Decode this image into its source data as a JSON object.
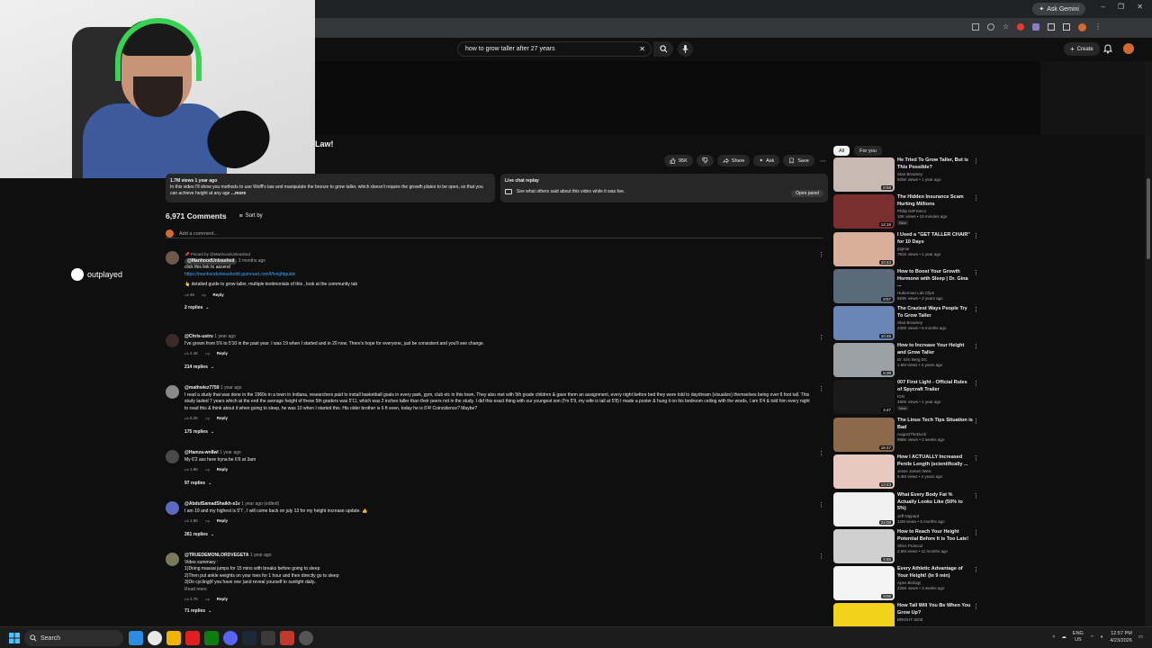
{
  "browser": {
    "ask_gemini": "Ask Gemini",
    "win_min": "–",
    "win_max": "❐",
    "win_close": "✕"
  },
  "header": {
    "search_query": "how to grow taller after 27 years",
    "create_label": "Create"
  },
  "webcam_brand": "outplayed",
  "video": {
    "title_tail": "Law!",
    "likes": "95K",
    "share": "Share",
    "ask": "Ask",
    "save": "Save",
    "desc_meta": "1.7M views  1 year ago",
    "desc_text": "In this video I'll show you methods to use Wolff's law and manipulate the bronze to grow taller, which doesn't require the growth plates to be open, so that you can achieve height at any age",
    "desc_more": "...more",
    "chat_title": "Live chat replay",
    "chat_text": "See what others said about this video while it was live.",
    "chat_open": "Open panel"
  },
  "comments_header": {
    "count": "6,971 Comments",
    "sort": "Sort by",
    "add_placeholder": "Add a comment..."
  },
  "comments": [
    {
      "pinned": "Pinned by @ManhoodUnleashed",
      "author": "@ManhoodUnleashed",
      "when": "3 months ago",
      "lines": [
        "click this link to ascend"
      ],
      "link": "https://manhoodunleashedd.gumroad.com/l/heightguide",
      "extra": "👆 detailed guide to grow taller, multiple testimonials of this , look at the community tab",
      "likes": "46",
      "reply": "Reply",
      "replies": "2 replies"
    },
    {
      "author": "@Chris-ustru",
      "when": "1 year ago",
      "lines": [
        "I've grown from 5'6 to 5'10 in the past year. I was 19 when I started and in 20 now. There's hope for everyone, just be consistent and you'll see change."
      ],
      "likes": "4.4K",
      "reply": "Reply",
      "replies": "214 replies"
    },
    {
      "author": "@mathwiez7759",
      "when": "1 year ago",
      "lines": [
        "I read a study that was done in the 1960s in a town in Indiana, researchers paid to install basketball goals in every park, gym, club etc in this town. They also met with 5th grade children & gave them an assignment, every night before bed they were told to daydream (visualize) themselves being over 6 foot tall. This study lasted 7 years which at the end the average height of these 5th graders was 5'11, which was 2 inches taller than their peers not in the study. I did this exact thing with our youngest son (I'm 5'9, my wife is tall at 5'8) I made a poster & hung it on his bedroom ceiling with the words, I am 6'4 & told him every night to read this & think about it when going to sleep, he was 10 when I started this. His older brother is 6 ft even, today he is 6'4! Coincidence? Maybe?"
      ],
      "likes": "5.2K",
      "reply": "Reply",
      "replies": "175 replies"
    },
    {
      "author": "@Hamza-wn8wl",
      "when": "1 year ago",
      "lines": [
        "My 6'2 ass here tryna be 6'6 at 3am"
      ],
      "likes": "1.8K",
      "reply": "Reply",
      "replies": "97 replies"
    },
    {
      "author": "@AbdulSamadShaikh-s1v",
      "when": "1 year ago (edited)",
      "lines": [
        "I am 19 and my highest is 5'7 , I will come back on july 13 for my height increase update. 👍"
      ],
      "likes": "1.8K",
      "reply": "Reply",
      "replies": "261 replies"
    },
    {
      "author": "@TRUEDEMONLORDVEGETA",
      "when": "1 year ago",
      "lines": [
        "Video summary :",
        "1)Doing massai jumps for 15 mins with breaks before going to sleep",
        "2)Then put ankle weights on your toes for 1 hour and then directly go to sleep",
        "3)Do cycling(if you have one )and reveal yourself to  sunlight daily.."
      ],
      "readmore": "Read more",
      "likes": "2.7K",
      "reply": "Reply",
      "replies": "71 replies"
    }
  ],
  "sidebar": {
    "chips": [
      "All",
      "For you"
    ],
    "recs": [
      {
        "title": "He Tried To Grow Taller, But is This Possible?",
        "channel": "Stan Browney",
        "stats": "925K views • 1 year ago",
        "dur": "8:58",
        "color": "#c9b9b3"
      },
      {
        "title": "The Hidden Insurance Scam Hurting Millions",
        "channel": "Philip DeFranco",
        "stats": "10K views • 19 minutes ago",
        "badge": "New",
        "dur": "14:15",
        "color": "#7a2e2e"
      },
      {
        "title": "I Used a \"GET TALLER CHAIR\" for 10 Days",
        "channel": "pigmie",
        "stats": "791K views • 1 year ago",
        "dur": "10:43",
        "color": "#d8b09a"
      },
      {
        "title": "How to Boost Your Growth Hormone with Sleep | Dr. Gina ...",
        "channel": "Huberman Lab Clips",
        "stats": "663K views • 2 years ago",
        "dur": "8:57",
        "color": "#5a6a78"
      },
      {
        "title": "The Craziest Ways People Try To Grow Taller",
        "channel": "Stan Browney",
        "stats": "230K views • 9 months ago",
        "dur": "10:45",
        "color": "#6a86b8"
      },
      {
        "title": "How to Increase Your Height and Grow Taller",
        "channel": "Dr. Eric Berg DC",
        "stats": "1.6M views • 4 years ago",
        "dur": "5:38",
        "color": "#9aa0a6"
      },
      {
        "title": "007 First Light - Official Rules of Spycraft Trailer",
        "channel": "IGN",
        "stats": "490K views • 1 year ago",
        "badge": "New",
        "dur": "4:47",
        "color": "#1a1a1a"
      },
      {
        "title": "The Linus Tech Tips Situation is Bad",
        "channel": "AugustTheDuck",
        "stats": "996K views • 2 weeks ago",
        "dur": "16:47",
        "color": "#8a6a4a"
      },
      {
        "title": "How I ACTUALLY Increased Penile Length (scientifically ...",
        "channel": "Jesse James West",
        "stats": "5.3M views • 2 years ago",
        "dur": "13:43",
        "color": "#e8c8c0"
      },
      {
        "title": "What Every Body Fat % Actually Looks Like (50% to 5%)",
        "channel": "Jeff Nippard",
        "stats": "12M views • 5 months ago",
        "dur": "24:08",
        "color": "#f0f0f0"
      },
      {
        "title": "How to Reach Your Height Potential Before It is Too Late!",
        "channel": "Shiro Protocol",
        "stats": "2.6M views • 11 months ago",
        "dur": "5:55",
        "color": "#d0d0d0"
      },
      {
        "title": "Every Athletic Advantage of Your Height! (In 9 min)",
        "channel": "Apex Biology",
        "stats": "225K views • 3 weeks ago",
        "dur": "9:06",
        "color": "#f4f4f4"
      },
      {
        "title": "How Tall Will You Be When You Grow Up?",
        "channel": "BRIGHT SIDE",
        "stats": "",
        "dur": "",
        "color": "#f2d21a"
      }
    ]
  },
  "taskbar": {
    "search": "Search",
    "lang": "ENG",
    "region": "US",
    "time": "12:57 PM",
    "date": "4/23/2026"
  }
}
